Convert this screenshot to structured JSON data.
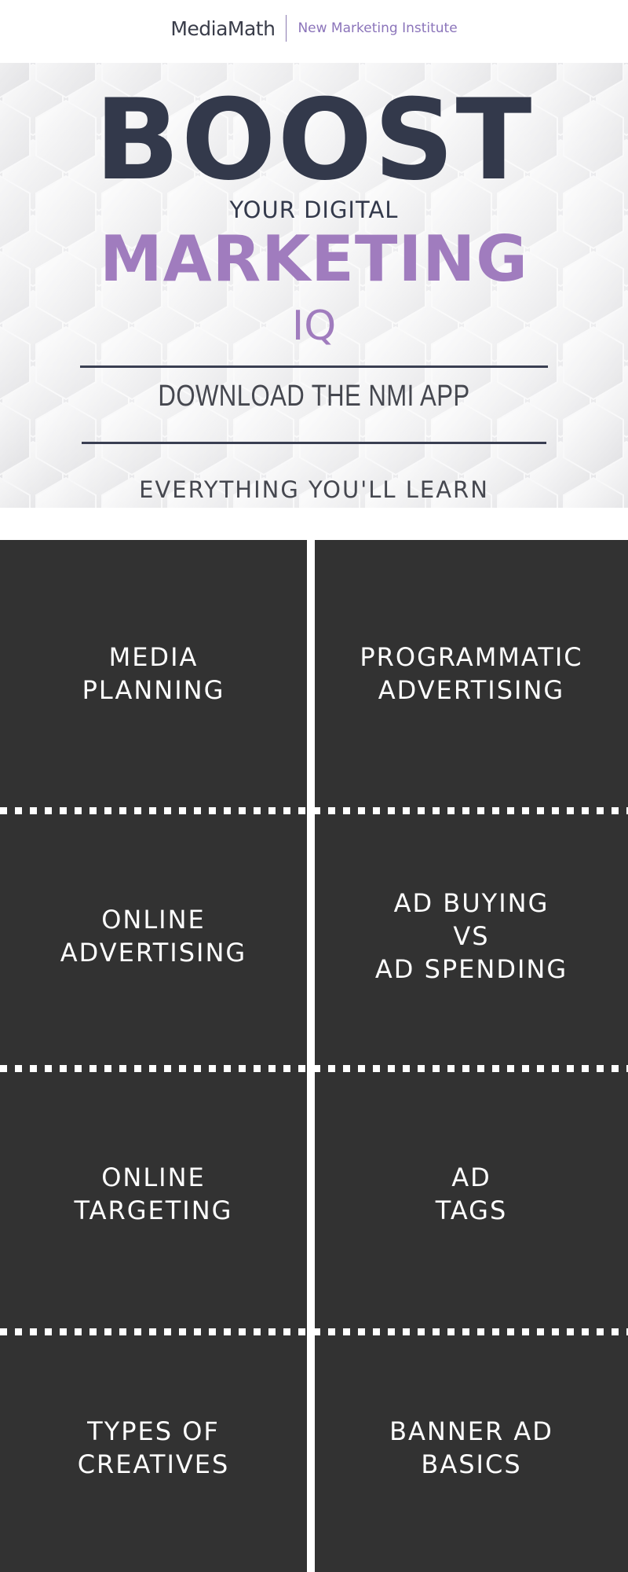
{
  "header": {
    "brand": "MediaMath",
    "institute": "New Marketing Institute"
  },
  "hero": {
    "headline": "BOOST",
    "subhead": "YOUR DIGITAL",
    "marketing": "MARKETING",
    "iq": "IQ",
    "cta": "DOWNLOAD THE NMI APP",
    "section_title": "EVERYTHING YOU'LL LEARN"
  },
  "topics": {
    "left": [
      "MEDIA\nPLANNING",
      "ONLINE\nADVERTISING",
      "ONLINE\nTARGETING",
      "TYPES OF\nCREATIVES"
    ],
    "right": [
      "PROGRAMMATIC\nADVERTISING",
      "AD BUYING\nVS\nAD SPENDING",
      "AD\nTAGS",
      "BANNER AD\nBASICS"
    ]
  },
  "colors": {
    "dark_navy": "#33394b",
    "purple": "#a07cbe",
    "tile_bg": "#323232",
    "tile_text": "#ffffff"
  }
}
